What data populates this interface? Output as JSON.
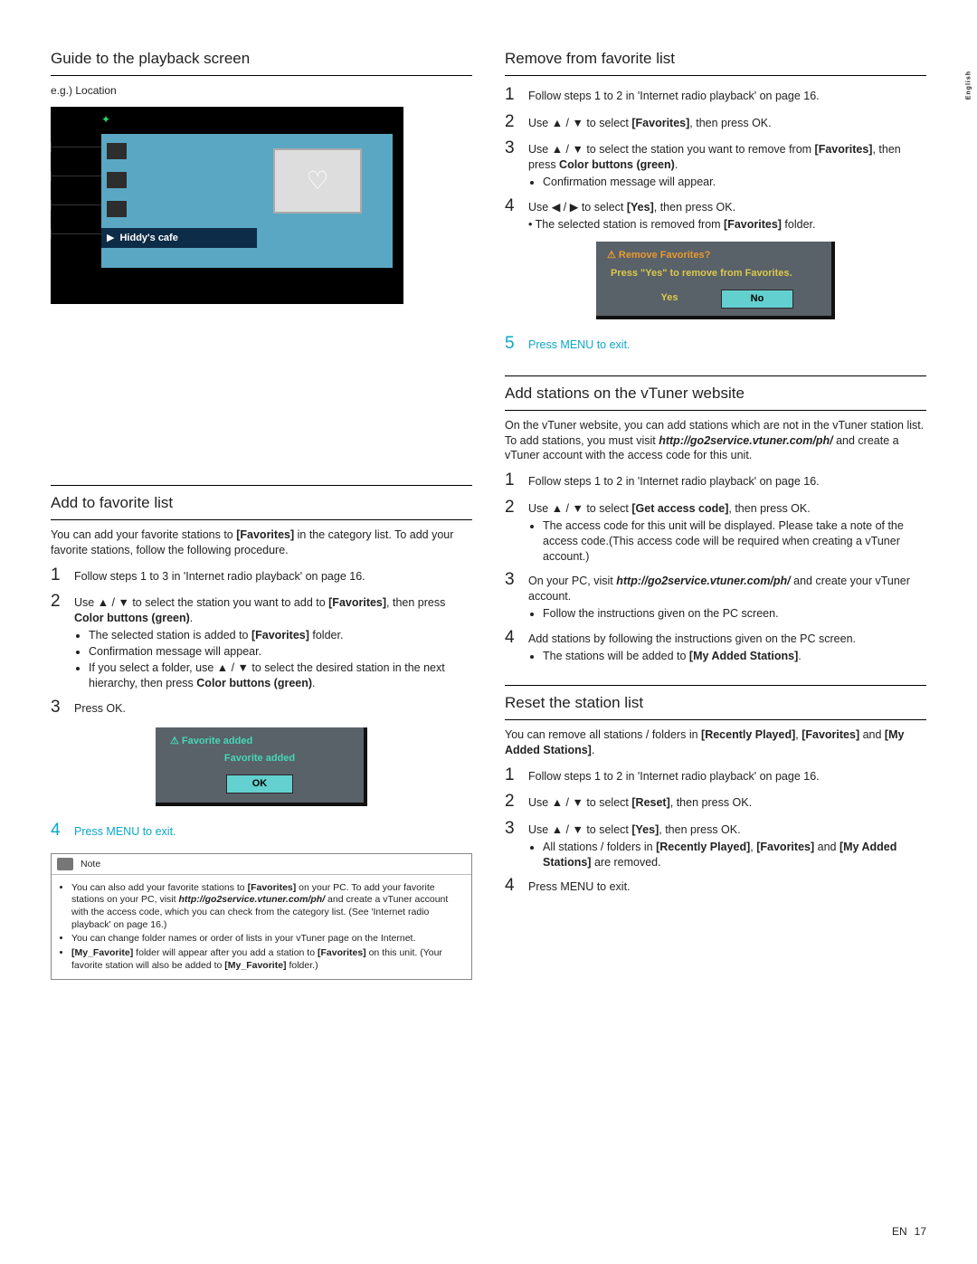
{
  "language_tab": "English",
  "footer": {
    "lang": "EN",
    "page": "17"
  },
  "left": {
    "sec1_title": "Guide to the playback screen",
    "sec1_sub": "e.g.) Location",
    "screenshot_selected": "Hiddy's cafe",
    "sec2_title": "Add to favorite list",
    "sec2_intro_1": "You can add your favorite stations to ",
    "sec2_intro_b": "[Favorites]",
    "sec2_intro_2": " in the category list. To add your favorite stations, follow the following procedure.",
    "step1": "Follow steps 1 to 3 in 'Internet radio playback' on page 16.",
    "step2_a": "Use ▲ / ▼ to select the station you want to add to ",
    "step2_b": "[Favorites]",
    "step2_c": ", then press ",
    "step2_d": "Color buttons (green)",
    "step2_e": ".",
    "step2_li1_a": "The selected station is added to ",
    "step2_li1_b": "[Favorites]",
    "step2_li1_c": " folder.",
    "step2_li2": "Confirmation message will appear.",
    "step2_li3_a": "If you select a folder, use ▲ / ▼ to select the desired station in the next hierarchy, then press ",
    "step2_li3_b": "Color buttons (green)",
    "step2_li3_c": ".",
    "step3": "Press OK.",
    "dialog_title": "⚠ Favorite added",
    "dialog_sub": "Favorite added",
    "dialog_ok": "OK",
    "step4": "Press MENU to exit.",
    "note_label": "Note",
    "note1_a": "You can also add your favorite stations to ",
    "note1_b": "[Favorites]",
    "note1_c": " on your PC. To add your favorite stations on your PC, visit ",
    "note1_url": "http://go2service.vtuner.com/ph/",
    "note1_d": " and create a vTuner account with the access code, which you can check from the category list. (See 'Internet radio playback' on page 16.)",
    "note2": "You can change folder names or order of lists in your vTuner page on the Internet.",
    "note3_a": "[My_Favorite]",
    "note3_b": " folder will appear after you add a station to ",
    "note3_c": "[Favorites]",
    "note3_d": " on this unit. (Your favorite station will also be added to ",
    "note3_e": "[My_Favorite]",
    "note3_f": " folder.)"
  },
  "right": {
    "sec1_title": "Remove from favorite list",
    "r_step1": "Follow steps 1 to 2 in 'Internet radio playback' on page 16.",
    "r_step2_a": "Use ▲ / ▼ to select ",
    "r_step2_b": "[Favorites]",
    "r_step2_c": ", then press OK.",
    "r_step3_a": "Use ▲ / ▼ to select the station you want to remove from ",
    "r_step3_b": "[Favorites]",
    "r_step3_c": ", then press ",
    "r_step3_d": "Color buttons (green)",
    "r_step3_e": ".",
    "r_step3_li1": "Confirmation message will appear.",
    "r_step4_a": "Use ◀ / ▶ to select ",
    "r_step4_b": "[Yes]",
    "r_step4_c": ", then press OK.",
    "r_step4_sub_a": "• The selected station is removed from ",
    "r_step4_sub_b": "[Favorites]",
    "r_step4_sub_c": " folder.",
    "rm_title": "⚠ Remove Favorites?",
    "rm_msg": "Press \"Yes\" to remove from Favorites.",
    "rm_yes": "Yes",
    "rm_no": "No",
    "r_step5": "Press MENU to exit.",
    "sec2_title": "Add stations on the vTuner website",
    "sec2_intro_a": "On the vTuner website, you can add stations which are not in the vTuner station list. To add stations, you must visit ",
    "sec2_intro_url": "http://go2service.vtuner.com/ph/",
    "sec2_intro_b": " and create a vTuner account with the access code for this unit.",
    "v_step1": "Follow steps 1 to 2 in 'Internet radio playback' on page 16.",
    "v_step2_a": "Use ▲ / ▼ to select ",
    "v_step2_b": "[Get access code]",
    "v_step2_c": ", then press OK.",
    "v_step2_li1": "The access code for this unit will be displayed. Please take a note of the access code.(This access code will be required when creating a vTuner account.)",
    "v_step3_a": "On your PC, visit ",
    "v_step3_url": "http://go2service.vtuner.com/ph/",
    "v_step3_b": " and create your vTuner account.",
    "v_step3_li1": "Follow the instructions given on the PC screen.",
    "v_step4": "Add stations by following the instructions given on the PC screen.",
    "v_step4_li1_a": "The stations will be added to ",
    "v_step4_li1_b": "[My Added Stations]",
    "v_step4_li1_c": ".",
    "sec3_title": "Reset the station list",
    "sec3_intro_a": "You can remove all stations / folders in ",
    "sec3_intro_b": "[Recently Played]",
    "sec3_intro_c": ", ",
    "sec3_intro_d": "[Favorites]",
    "sec3_intro_e": " and ",
    "sec3_intro_f": "[My Added Stations]",
    "sec3_intro_g": ".",
    "rs_step1": "Follow steps 1 to 2 in 'Internet radio playback' on page 16.",
    "rs_step2_a": "Use ▲ / ▼ to select ",
    "rs_step2_b": "[Reset]",
    "rs_step2_c": ", then press OK.",
    "rs_step3_a": "Use ▲ / ▼ to select ",
    "rs_step3_b": "[Yes]",
    "rs_step3_c": ", then press OK.",
    "rs_step3_li1_a": "All stations / folders in ",
    "rs_step3_li1_b": "[Recently Played]",
    "rs_step3_li1_c": ", ",
    "rs_step3_li1_d": "[Favorites]",
    "rs_step3_li1_e": "  and ",
    "rs_step3_li1_f": "[My Added Stations]",
    "rs_step3_li1_g": " are removed.",
    "rs_step4": "Press MENU to exit."
  }
}
